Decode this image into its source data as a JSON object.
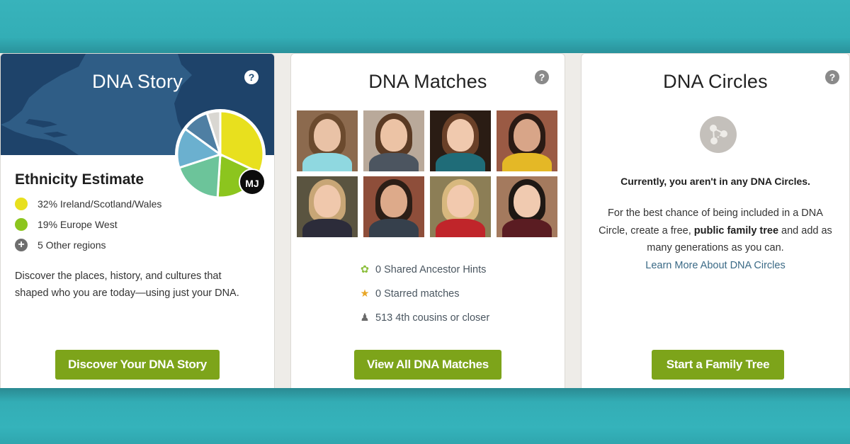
{
  "cards": {
    "story": {
      "title": "DNA Story",
      "help_label": "?",
      "section_title": "Ethnicity Estimate",
      "regions": [
        {
          "label": "32% Ireland/Scotland/Wales",
          "color": "#e8e01e"
        },
        {
          "label": "19% Europe West",
          "color": "#8cc51e"
        },
        {
          "label": "5 Other regions",
          "icon": "plus-circle-icon"
        }
      ],
      "avatar_initials": "MJ",
      "description": "Discover the places, history, and cultures that shaped who you are today—using just your DNA.",
      "button_label": "Discover Your DNA Story"
    },
    "matches": {
      "title": "DNA Matches",
      "help_label": "?",
      "photos_count": 8,
      "stats": [
        {
          "icon": "leaf-icon",
          "label": "0 Shared Ancestor Hints"
        },
        {
          "icon": "star-icon",
          "label": "0 Starred matches"
        },
        {
          "icon": "people-icon",
          "label": "513 4th cousins or closer"
        }
      ],
      "button_label": "View All DNA Matches"
    },
    "circles": {
      "title": "DNA Circles",
      "help_label": "?",
      "status": "Currently, you aren't in any DNA Circles.",
      "desc_part1": "For the best chance of being included in a DNA Circle, create a free, ",
      "desc_bold": "public family tree",
      "desc_part2": " and add as many generations as you can.",
      "link_label": "Learn More About DNA Circles",
      "button_label": "Start a Family Tree"
    }
  },
  "chart_data": {
    "type": "pie",
    "title": "Ethnicity Estimate",
    "slices": [
      {
        "label": "Ireland/Scotland/Wales",
        "value": 32,
        "color": "#e8e01e"
      },
      {
        "label": "Europe West",
        "value": 19,
        "color": "#8cc51e"
      },
      {
        "label": "Other region 1",
        "value": 19,
        "color": "#6cc49a"
      },
      {
        "label": "Other region 2",
        "value": 15,
        "color": "#6bb0cf"
      },
      {
        "label": "Other region 3",
        "value": 10,
        "color": "#4f7fa3"
      },
      {
        "label": "Other region 4",
        "value": 5,
        "color": "#d9d7d2"
      }
    ]
  },
  "colors": {
    "button_green": "#7da41a",
    "teal_background": "#33b0b8",
    "map_blue": "#2f5d86"
  }
}
